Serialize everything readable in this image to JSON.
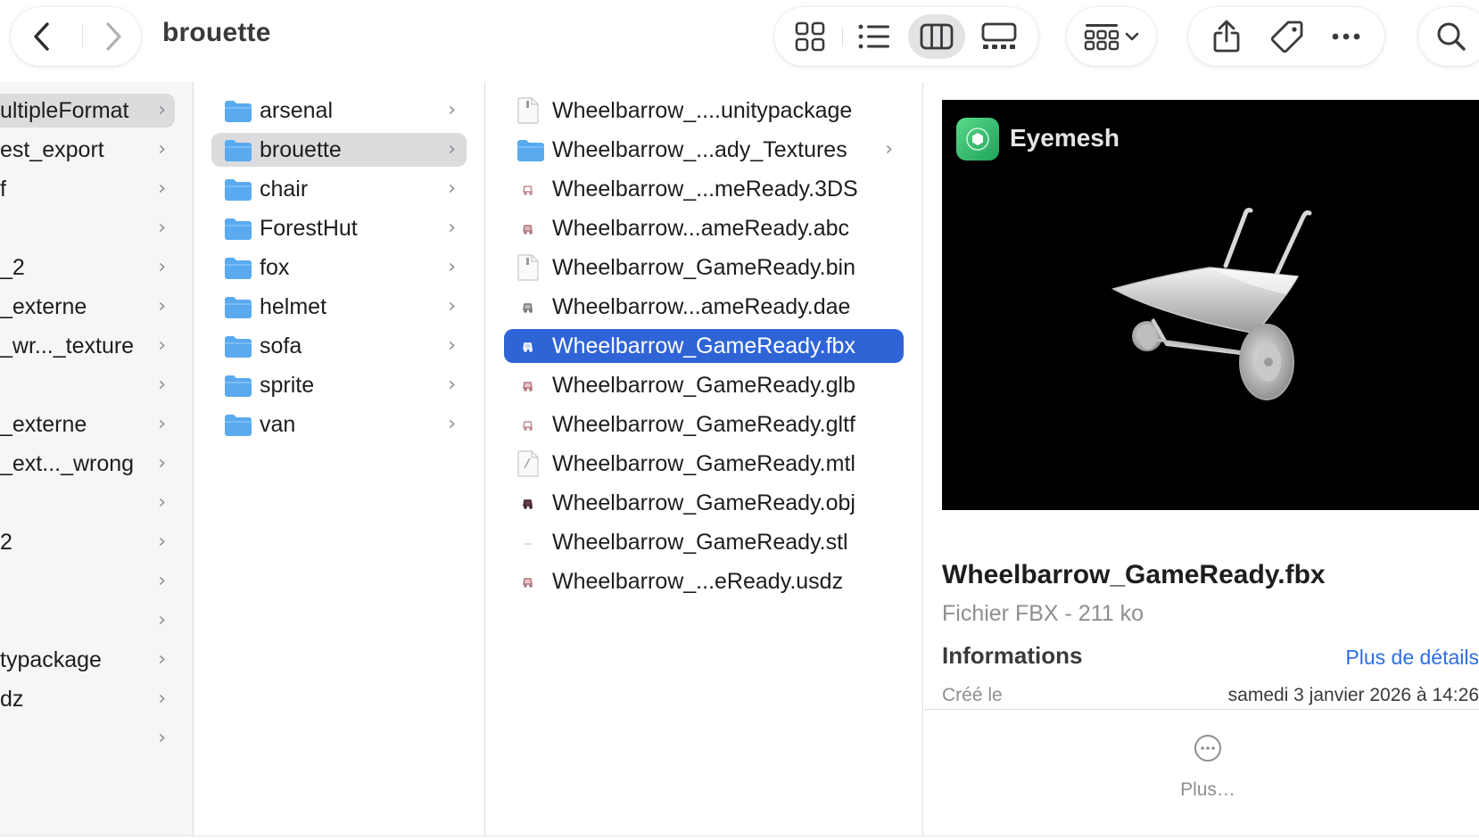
{
  "window": {
    "title": "brouette"
  },
  "toolbar": {
    "back_icon": "chevron-left-icon",
    "forward_icon": "chevron-right-icon",
    "view_modes": [
      "icon-grid-view",
      "list-view",
      "column-view",
      "gallery-view"
    ],
    "active_view": "column-view",
    "group_icon": "group-by-icon",
    "share_icon": "share-icon",
    "tag_icon": "tag-icon",
    "more_icon": "ellipsis-icon",
    "search_icon": "search-icon"
  },
  "column1": {
    "items": [
      {
        "label": "ultipleFormat",
        "selected": true
      },
      {
        "label": "est_export"
      },
      {
        "label": "f"
      },
      {
        "label": ""
      },
      {
        "label": "_2"
      },
      {
        "label": "_externe"
      },
      {
        "label": "_wr..._texture"
      },
      {
        "label": ""
      },
      {
        "label": "_externe"
      },
      {
        "label": "_ext..._wrong"
      },
      {
        "label": ""
      },
      {
        "label": "2"
      },
      {
        "label": ""
      },
      {
        "label": ""
      },
      {
        "label": "typackage"
      },
      {
        "label": "dz"
      },
      {
        "label": ""
      }
    ]
  },
  "column2": {
    "items": [
      {
        "label": "arsenal"
      },
      {
        "label": "brouette",
        "selected": true
      },
      {
        "label": "chair"
      },
      {
        "label": "ForestHut"
      },
      {
        "label": "fox"
      },
      {
        "label": "helmet"
      },
      {
        "label": "sofa"
      },
      {
        "label": "sprite"
      },
      {
        "label": "van"
      }
    ]
  },
  "column3": {
    "items": [
      {
        "label": "Wheelbarrow_....unitypackage",
        "type": "document"
      },
      {
        "label": "Wheelbarrow_...ady_Textures",
        "type": "folder"
      },
      {
        "label": "Wheelbarrow_...meReady.3DS",
        "type": "model"
      },
      {
        "label": "Wheelbarrow...ameReady.abc",
        "type": "model"
      },
      {
        "label": "Wheelbarrow_GameReady.bin",
        "type": "document"
      },
      {
        "label": "Wheelbarrow...ameReady.dae",
        "type": "model"
      },
      {
        "label": "Wheelbarrow_GameReady.fbx",
        "type": "model",
        "selected": true
      },
      {
        "label": "Wheelbarrow_GameReady.glb",
        "type": "model"
      },
      {
        "label": "Wheelbarrow_GameReady.gltf",
        "type": "model"
      },
      {
        "label": "Wheelbarrow_GameReady.mtl",
        "type": "document"
      },
      {
        "label": "Wheelbarrow_GameReady.obj",
        "type": "model"
      },
      {
        "label": "Wheelbarrow_GameReady.stl",
        "type": "stl"
      },
      {
        "label": "Wheelbarrow_...eReady.usdz",
        "type": "model"
      }
    ]
  },
  "preview": {
    "app_name": "Eyemesh",
    "filename": "Wheelbarrow_GameReady.fbx",
    "kind": "Fichier FBX - 211 ko",
    "info_title": "Informations",
    "more_details": "Plus de détails",
    "created_label": "Créé le",
    "created_value": "samedi 3 janvier 2026 à 14:26",
    "plus_label": "Plus…"
  },
  "colors": {
    "selection_blue": "#2f64d6",
    "selection_gray": "#dcdcdf",
    "folder_blue": "#5aaaf0",
    "link_blue": "#2f6de1",
    "app_badge_green": "#27b562"
  }
}
